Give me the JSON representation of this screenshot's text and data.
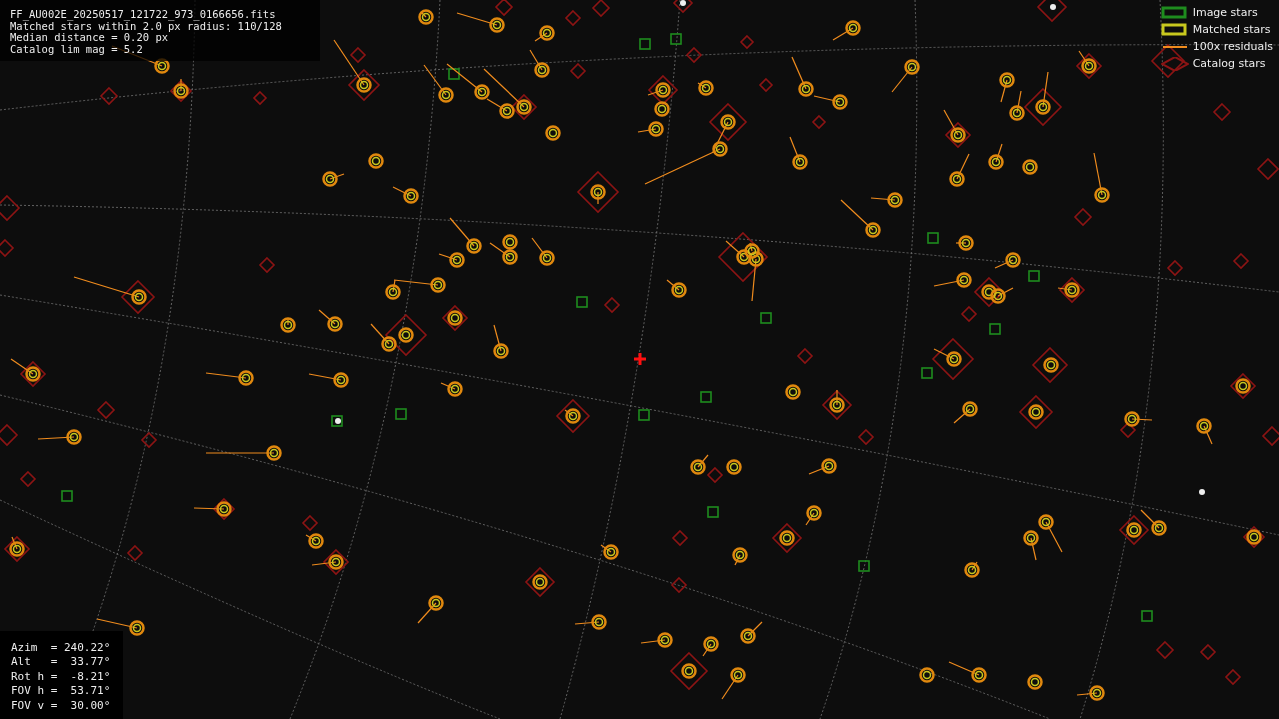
{
  "info_lines": [
    "FF_AU002E_20250517_121722_973_0166656.fits",
    "Matched stars within 2.0 px radius: 110/128",
    "Median distance = 0.20 px",
    "Catalog lim mag = 5.2"
  ],
  "legend": [
    {
      "kind": "image",
      "label": "Image stars",
      "color": "#1e8c1e"
    },
    {
      "kind": "matched",
      "label": "Matched stars",
      "color": "#c8c81e"
    },
    {
      "kind": "residual",
      "label": "100x residuals",
      "color": "#f08c1e"
    },
    {
      "kind": "catalog",
      "label": "Catalog stars",
      "color": "#8c1414"
    }
  ],
  "pointing_lines": [
    "Azim  = 240.22°",
    "Alt   =  33.77°",
    "Rot h =  -8.21°",
    "FOV h =  53.71°",
    "FOV v =  30.00°"
  ]
}
